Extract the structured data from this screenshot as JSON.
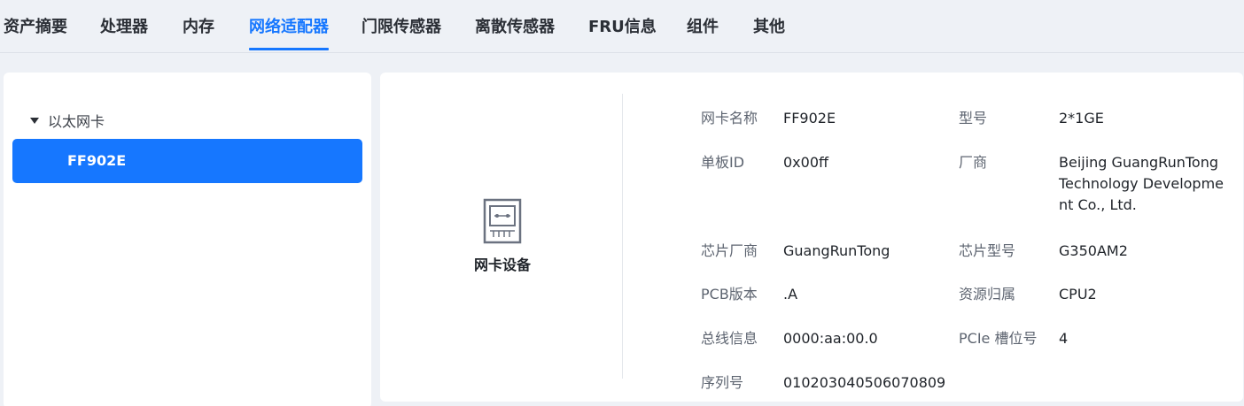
{
  "tabs": [
    {
      "label": "资产摘要"
    },
    {
      "label": "处理器"
    },
    {
      "label": "内存"
    },
    {
      "label": "网络适配器",
      "active": true
    },
    {
      "label": "门限传感器"
    },
    {
      "label": "离散传感器"
    },
    {
      "label": "FRU信息"
    },
    {
      "label": "组件"
    },
    {
      "label": "其他"
    }
  ],
  "tree": {
    "group_label": "以太网卡",
    "items": [
      {
        "label": "FF902E",
        "selected": true
      }
    ]
  },
  "device": {
    "icon": "network-card-icon",
    "label": "网卡设备"
  },
  "fields": {
    "nic_name": {
      "label": "网卡名称",
      "value": "FF902E"
    },
    "model": {
      "label": "型号",
      "value": "2*1GE"
    },
    "board_id": {
      "label": "单板ID",
      "value": "0x00ff"
    },
    "vendor": {
      "label": "厂商",
      "value": "Beijing GuangRunTong Technology Development Co., Ltd."
    },
    "chip_vendor": {
      "label": "芯片厂商",
      "value": "GuangRunTong"
    },
    "chip_model": {
      "label": "芯片型号",
      "value": "G350AM2"
    },
    "pcb_version": {
      "label": "PCB版本",
      "value": ".A"
    },
    "resource_owner": {
      "label": "资源归属",
      "value": "CPU2"
    },
    "bus_info": {
      "label": "总线信息",
      "value": "0000:aa:00.0"
    },
    "pcie_slot": {
      "label": "PCIe 槽位号",
      "value": "4"
    },
    "serial_number": {
      "label": "序列号",
      "value": "010203040506070809"
    }
  },
  "colors": {
    "accent": "#1677ff",
    "background": "#eef1f6",
    "panel": "#ffffff"
  }
}
